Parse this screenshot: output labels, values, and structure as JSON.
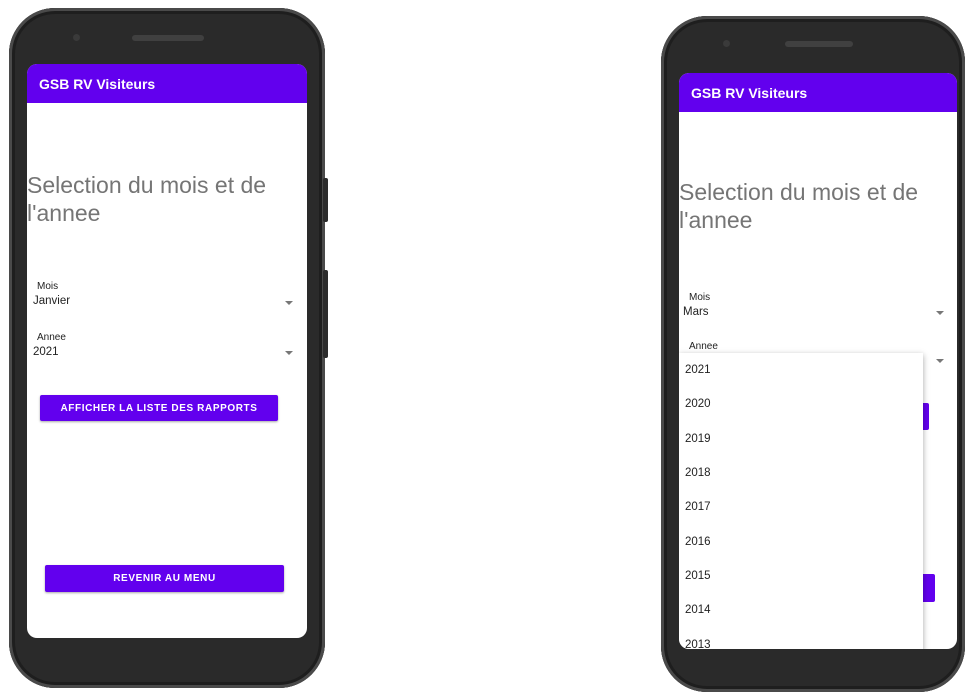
{
  "left_screen": {
    "app_title": "GSB RV Visiteurs",
    "heading": "Selection du mois et de l'annee",
    "month_label": "Mois",
    "month_value": "Janvier",
    "year_label": "Annee",
    "year_value": "2021",
    "show_reports_button": "AFFICHER LA LISTE DES RAPPORTS",
    "back_button": "REVENIR AU MENU"
  },
  "right_screen": {
    "app_title": "GSB RV Visiteurs",
    "heading": "Selection du mois et de l'annee",
    "month_label": "Mois",
    "month_value": "Mars",
    "year_label": "Annee",
    "year_options": [
      "2021",
      "2020",
      "2019",
      "2018",
      "2017",
      "2016",
      "2015",
      "2014",
      "2013"
    ]
  },
  "colors": {
    "primary": "#6200ee",
    "heading_text": "#757575"
  }
}
